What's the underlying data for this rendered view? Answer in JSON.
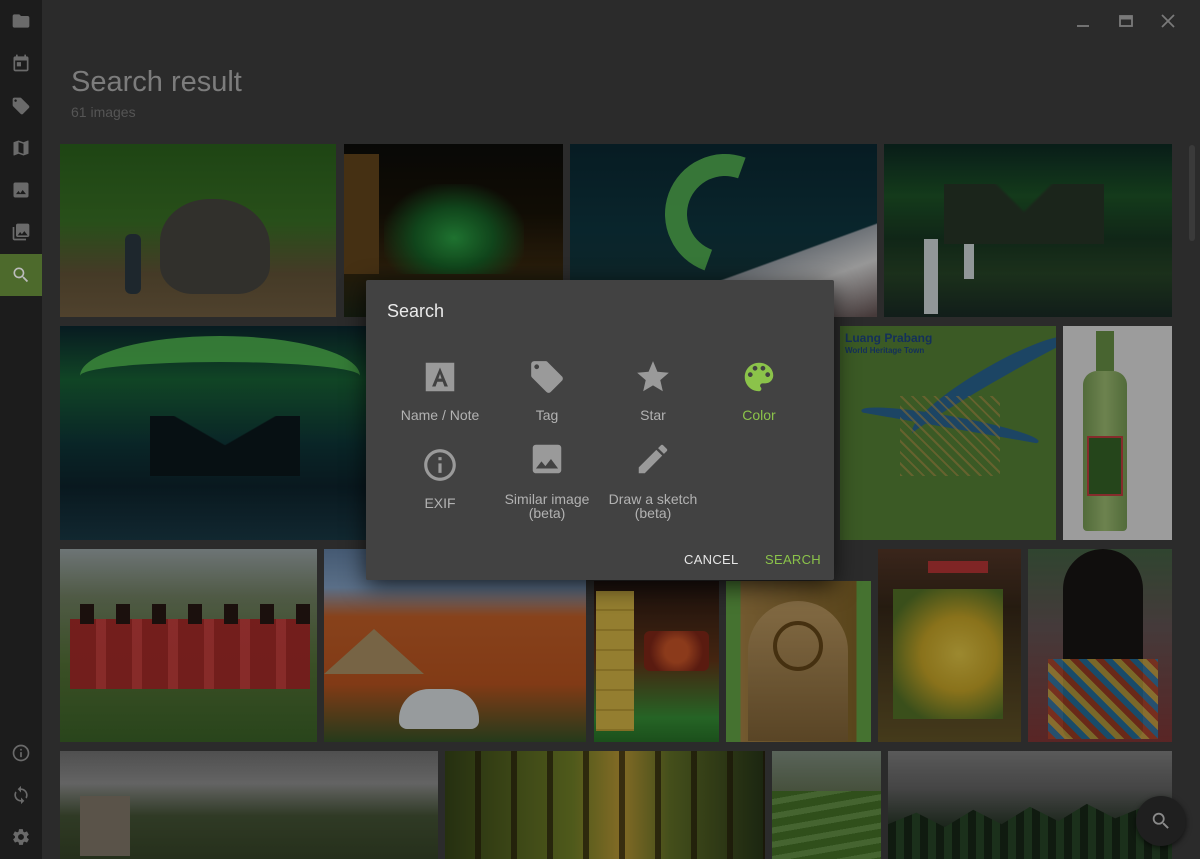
{
  "header": {
    "title": "Search result",
    "subtitle": "61 images"
  },
  "sidebar": {
    "items": [
      {
        "icon": "folder-icon"
      },
      {
        "icon": "calendar-icon"
      },
      {
        "icon": "tag-icon"
      },
      {
        "icon": "map-icon"
      },
      {
        "icon": "photo-icon"
      },
      {
        "icon": "photo-library-icon"
      },
      {
        "icon": "search-icon",
        "active": true
      },
      {
        "icon": "info-icon"
      },
      {
        "icon": "sync-icon"
      },
      {
        "icon": "settings-icon"
      }
    ]
  },
  "window_controls": [
    "minimize-icon",
    "maximize-icon",
    "close-icon"
  ],
  "dialog": {
    "title": "Search",
    "options": [
      {
        "label": "Name / Note",
        "icon": "text-a-icon"
      },
      {
        "label": "Tag",
        "icon": "tag-icon"
      },
      {
        "label": "Star",
        "icon": "star-icon"
      },
      {
        "label": "Color",
        "icon": "palette-icon",
        "selected": true
      },
      {
        "label": "EXIF",
        "icon": "info-icon"
      },
      {
        "label": "Similar image\n(beta)",
        "icon": "image-icon"
      },
      {
        "label": "Draw a sketch\n(beta)",
        "icon": "pencil-icon"
      }
    ],
    "cancel_label": "CANCEL",
    "search_label": "SEARCH"
  },
  "images": [
    {
      "subject": "elephant"
    },
    {
      "subject": "night building"
    },
    {
      "subject": "aurora mountains"
    },
    {
      "subject": "aurora waterfall"
    },
    {
      "subject": "aurora kirkjufell"
    },
    {
      "subject": "luang prabang map"
    },
    {
      "subject": "green bottle"
    },
    {
      "subject": "girls violins"
    },
    {
      "subject": "orange house beetle"
    },
    {
      "subject": "market shop"
    },
    {
      "subject": "golden door"
    },
    {
      "subject": "yellow flowers"
    },
    {
      "subject": "braided hair"
    },
    {
      "subject": "ruins cloudy"
    },
    {
      "subject": "forest"
    },
    {
      "subject": "rice terraces"
    },
    {
      "subject": "pine cliffs"
    }
  ],
  "colors": {
    "accent": "#8bc34a",
    "sidebar_active": "#4d6a2c",
    "dialog_bg": "#424242"
  }
}
